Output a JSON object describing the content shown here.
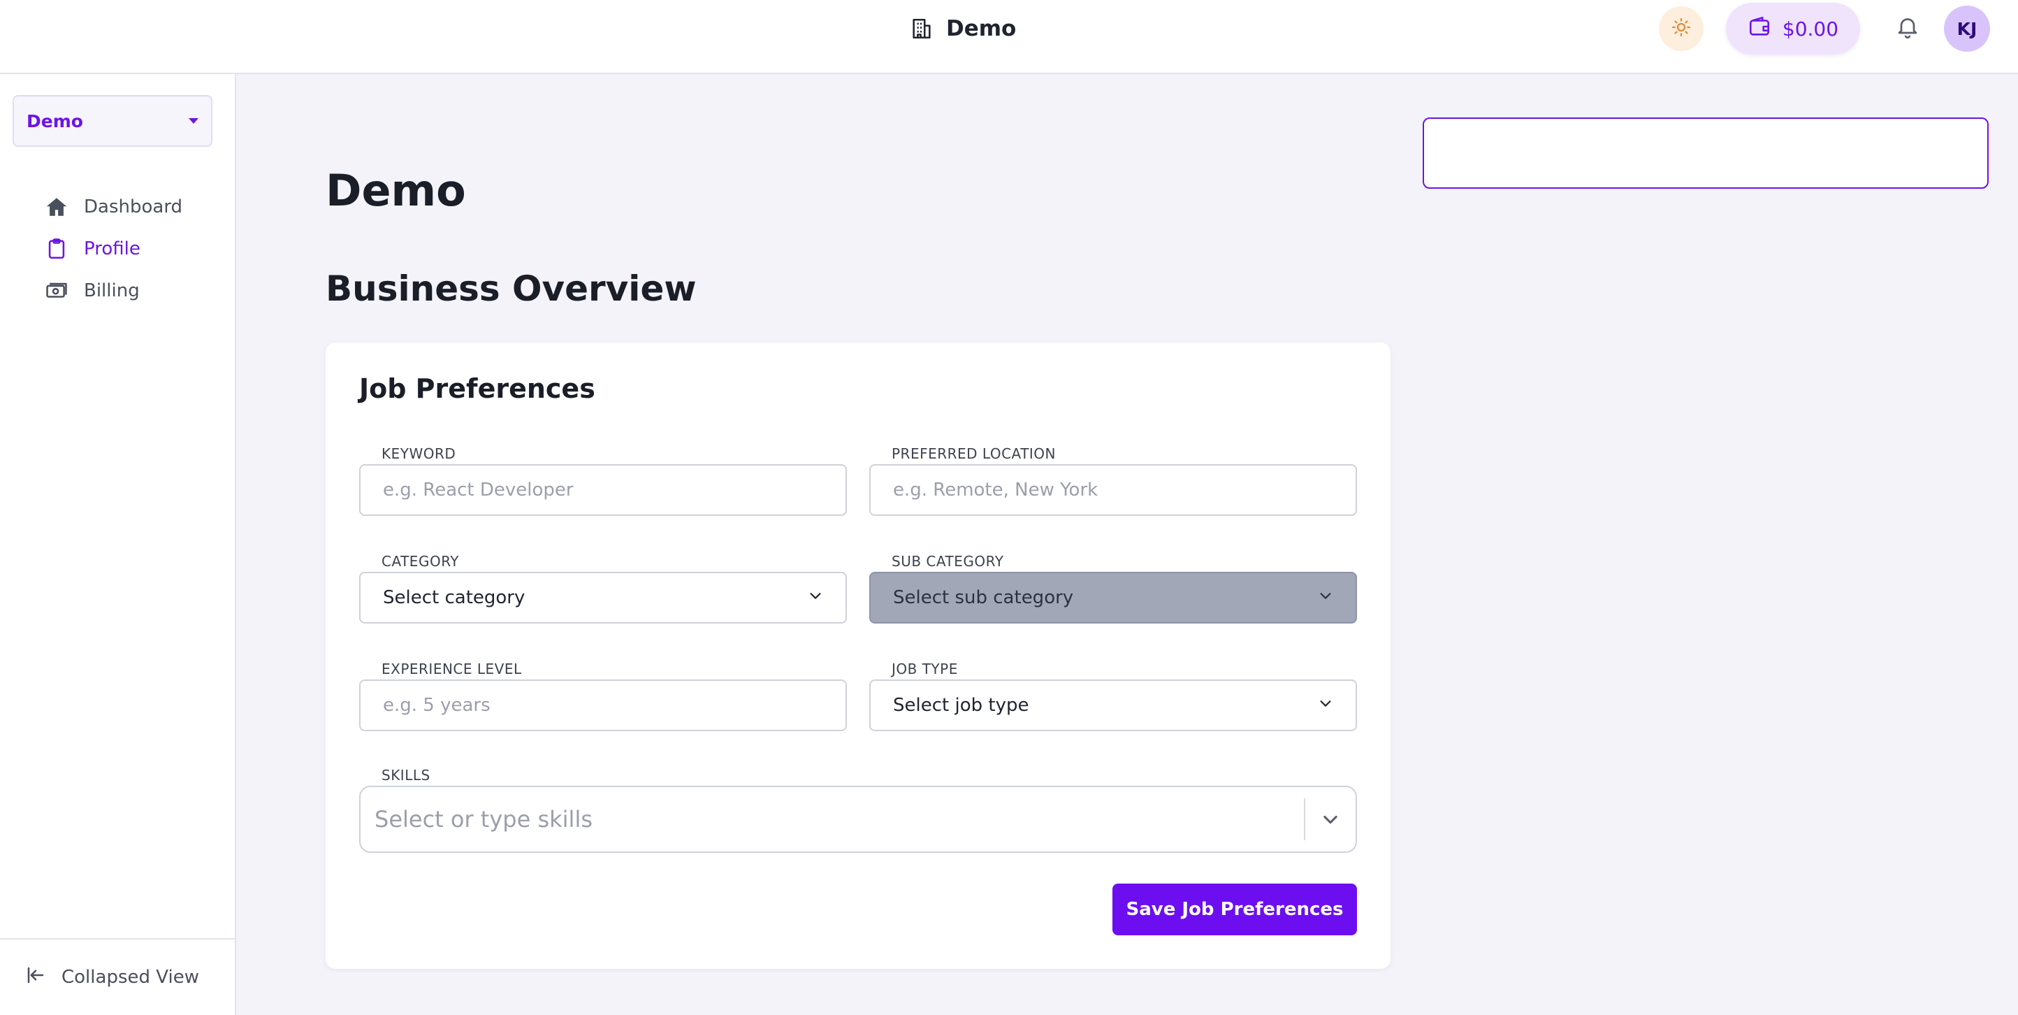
{
  "header": {
    "title": "Demo",
    "wallet_balance": "$0.00",
    "avatar_initials": "KJ"
  },
  "sidebar": {
    "org_select": "Demo",
    "items": [
      {
        "label": "Dashboard",
        "icon": "home-icon",
        "active": false
      },
      {
        "label": "Profile",
        "icon": "clipboard-icon",
        "active": true
      },
      {
        "label": "Billing",
        "icon": "money-icon",
        "active": false
      }
    ],
    "footer_label": "Collapsed View"
  },
  "main": {
    "page_title": "Demo",
    "section_title": "Business Overview",
    "search_value": "",
    "card": {
      "title": "Job Preferences",
      "fields": {
        "keyword": {
          "label": "KEYWORD",
          "placeholder": "e.g. React Developer"
        },
        "location": {
          "label": "PREFERRED LOCATION",
          "placeholder": "e.g. Remote, New York"
        },
        "category": {
          "label": "CATEGORY",
          "value": "Select category"
        },
        "sub_category": {
          "label": "SUB CATEGORY",
          "value": "Select sub category",
          "disabled": true
        },
        "experience": {
          "label": "EXPERIENCE LEVEL",
          "placeholder": "e.g. 5 years"
        },
        "job_type": {
          "label": "JOB TYPE",
          "value": "Select job type"
        },
        "skills": {
          "label": "SKILLS",
          "placeholder": "Select or type skills"
        }
      },
      "save_label": "Save Job Preferences"
    }
  },
  "colors": {
    "accent": "#6d14e6",
    "page_bg": "#f4f3fa",
    "disabled_select_bg": "#a2a7b8"
  }
}
